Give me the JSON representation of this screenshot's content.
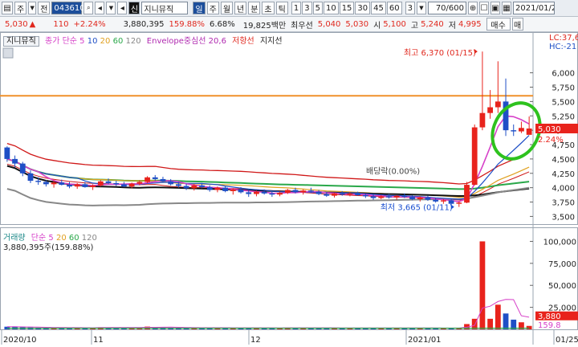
{
  "toolbar": {
    "market_label": "주",
    "market2_label": "전",
    "code": "043610",
    "type_badge": "신",
    "stock_name": "지니뮤직",
    "period_day": "일",
    "period_week": "주",
    "period_month": "월",
    "period_year": "년",
    "period_min": "분",
    "period_sec": "초",
    "period_tick": "틱",
    "intervals": [
      "1",
      "3",
      "5",
      "10",
      "15",
      "30",
      "45",
      "60"
    ],
    "count_3": "3",
    "range_value": "70/600",
    "date_value": "2021/01/25"
  },
  "quote": {
    "price": "5,030",
    "change": "110",
    "change_pct": "+2.24%",
    "volume": "3,880,395",
    "vol_ratio": "159.88%",
    "turnover": "6.68%",
    "amount": "19,825백만",
    "best_ask_label": "최우선",
    "ask": "5,040",
    "bid": "5,030",
    "open_label": "시",
    "open": "5,100",
    "high_label": "고",
    "high": "5,240",
    "low_label": "저",
    "low": "4,995",
    "sell_button": "매수",
    "buy_button": "매"
  },
  "legend": {
    "name": "지니뮤직",
    "ma_label": "종가 단순",
    "ma_periods": [
      "5",
      "10",
      "20",
      "60",
      "120"
    ],
    "envelope": "Envelope중심선 20,6",
    "resistance": "저항선",
    "support": "지지선",
    "lc": "LC:37,6",
    "hc": "HC:-21"
  },
  "annotations": {
    "high_note": "최고 6,370 (01/15)",
    "low_note": "최저 3,665 (01/11)",
    "dividend": "배당락(0.00%)",
    "price_tag": "5,030",
    "pct_tag": "2.24%"
  },
  "volume_legend": {
    "label": "거래량",
    "ma_label": "단순",
    "periods": [
      "5",
      "20",
      "60",
      "120"
    ],
    "value": "3,880,395주(159.88%)",
    "tag1": "3,880",
    "tag2": "159.8"
  },
  "chart_data": {
    "type": "candlestick",
    "price_axis": [
      "6,000",
      "5,750",
      "5,500",
      "5,250",
      "5,000",
      "4,750",
      "4,500",
      "4,250",
      "4,000",
      "3,750",
      "3,500"
    ],
    "price_ticks": [
      6000,
      5750,
      5500,
      5250,
      5000,
      4750,
      4500,
      4250,
      4000,
      3750,
      3500
    ],
    "volume_axis": [
      "100,000",
      "75,000",
      "50,000",
      "25,000"
    ],
    "volume_ticks": [
      100000,
      75000,
      50000,
      25000
    ],
    "x_labels": [
      "2020/10",
      "11",
      "12",
      "2021/01",
      "01/25"
    ],
    "resistance_level": 5600,
    "candles": [
      [
        4700,
        4720,
        4450,
        4500
      ],
      [
        4500,
        4560,
        4350,
        4420
      ],
      [
        4420,
        4450,
        4200,
        4250
      ],
      [
        4250,
        4300,
        4080,
        4120
      ],
      [
        4120,
        4180,
        4050,
        4100
      ],
      [
        4100,
        4130,
        4020,
        4060
      ],
      [
        4060,
        4120,
        4000,
        4090
      ],
      [
        4090,
        4140,
        4040,
        4050
      ],
      [
        4050,
        4100,
        3990,
        4020
      ],
      [
        4020,
        4080,
        3980,
        4060
      ],
      [
        4060,
        4100,
        4000,
        4010
      ],
      [
        4010,
        4060,
        3960,
        4040
      ],
      [
        4040,
        4130,
        4020,
        4110
      ],
      [
        4110,
        4160,
        4060,
        4080
      ],
      [
        4080,
        4120,
        4030,
        4060
      ],
      [
        4060,
        4100,
        4010,
        4020
      ],
      [
        4020,
        4090,
        3990,
        4070
      ],
      [
        4070,
        4130,
        4040,
        4100
      ],
      [
        4100,
        4200,
        4080,
        4180
      ],
      [
        4180,
        4220,
        4120,
        4150
      ],
      [
        4150,
        4190,
        4090,
        4110
      ],
      [
        4110,
        4150,
        4040,
        4060
      ],
      [
        4060,
        4100,
        4000,
        4030
      ],
      [
        4030,
        4070,
        3960,
        3990
      ],
      [
        3990,
        4060,
        3950,
        4040
      ],
      [
        4040,
        4080,
        3990,
        4010
      ],
      [
        4010,
        4040,
        3930,
        3960
      ],
      [
        3960,
        4020,
        3920,
        4000
      ],
      [
        4000,
        4030,
        3920,
        3940
      ],
      [
        3940,
        3990,
        3880,
        3970
      ],
      [
        3970,
        4010,
        3900,
        3920
      ],
      [
        3920,
        3960,
        3840,
        3890
      ],
      [
        3890,
        3950,
        3850,
        3930
      ],
      [
        3930,
        3970,
        3880,
        3900
      ],
      [
        3900,
        3940,
        3840,
        3880
      ],
      [
        3880,
        3930,
        3850,
        3910
      ],
      [
        3910,
        3980,
        3890,
        3960
      ],
      [
        3960,
        4000,
        3900,
        3920
      ],
      [
        3920,
        3970,
        3880,
        3950
      ],
      [
        3950,
        4000,
        3910,
        3930
      ],
      [
        3930,
        3960,
        3870,
        3890
      ],
      [
        3890,
        3920,
        3840,
        3860
      ],
      [
        3860,
        3910,
        3830,
        3900
      ],
      [
        3900,
        3940,
        3860,
        3880
      ],
      [
        3880,
        3920,
        3850,
        3900
      ],
      [
        3900,
        3930,
        3860,
        3870
      ],
      [
        3870,
        3900,
        3820,
        3850
      ],
      [
        3850,
        3880,
        3790,
        3820
      ],
      [
        3820,
        3870,
        3800,
        3850
      ],
      [
        3850,
        3890,
        3810,
        3830
      ],
      [
        3830,
        3870,
        3790,
        3860
      ],
      [
        3860,
        3900,
        3820,
        3840
      ],
      [
        3840,
        3870,
        3780,
        3800
      ],
      [
        3800,
        3850,
        3760,
        3830
      ],
      [
        3830,
        3860,
        3770,
        3790
      ],
      [
        3790,
        3820,
        3740,
        3760
      ],
      [
        3760,
        3800,
        3720,
        3780
      ],
      [
        3780,
        3810,
        3700,
        3720
      ],
      [
        3720,
        3760,
        3665,
        3740
      ],
      [
        3740,
        4100,
        3730,
        4050
      ],
      [
        4050,
        5100,
        4040,
        5050
      ],
      [
        5050,
        6370,
        5000,
        5300
      ],
      [
        5300,
        5700,
        5200,
        5400
      ],
      [
        5400,
        6200,
        5300,
        5500
      ],
      [
        5500,
        5900,
        4900,
        5000
      ],
      [
        5000,
        5100,
        4900,
        4980
      ],
      [
        4980,
        5150,
        4950,
        5040
      ],
      [
        4920,
        5240,
        4995,
        5030
      ]
    ],
    "volumes": [
      3000,
      2800,
      2500,
      2200,
      2000,
      1900,
      2100,
      1800,
      1700,
      1900,
      1800,
      1700,
      2400,
      2100,
      1900,
      1800,
      1900,
      2300,
      3100,
      2500,
      2200,
      2000,
      1800,
      1700,
      2000,
      1800,
      1700,
      1800,
      1900,
      1700,
      1800,
      1600,
      1700,
      1800,
      1600,
      1700,
      1900,
      1800,
      1700,
      1800,
      1700,
      1600,
      1700,
      1600,
      1700,
      1600,
      1500,
      1600,
      1700,
      1600,
      1700,
      1600,
      1500,
      1600,
      1500,
      1400,
      1500,
      1400,
      1600,
      6000,
      12000,
      100000,
      12000,
      28000,
      18000,
      11000,
      8000,
      3880
    ],
    "colors": {
      "up": "#e8231c",
      "down": "#1f4fc6",
      "ma5": "#d640c8",
      "ma10": "#1f4fc6",
      "ma20": "#e0a020",
      "ma60": "#2aa84a",
      "ma120": "#888888",
      "envelope": "#d01818",
      "support": "#111111",
      "resistance": "#f0902a",
      "highlight": "#2ec21e"
    }
  }
}
